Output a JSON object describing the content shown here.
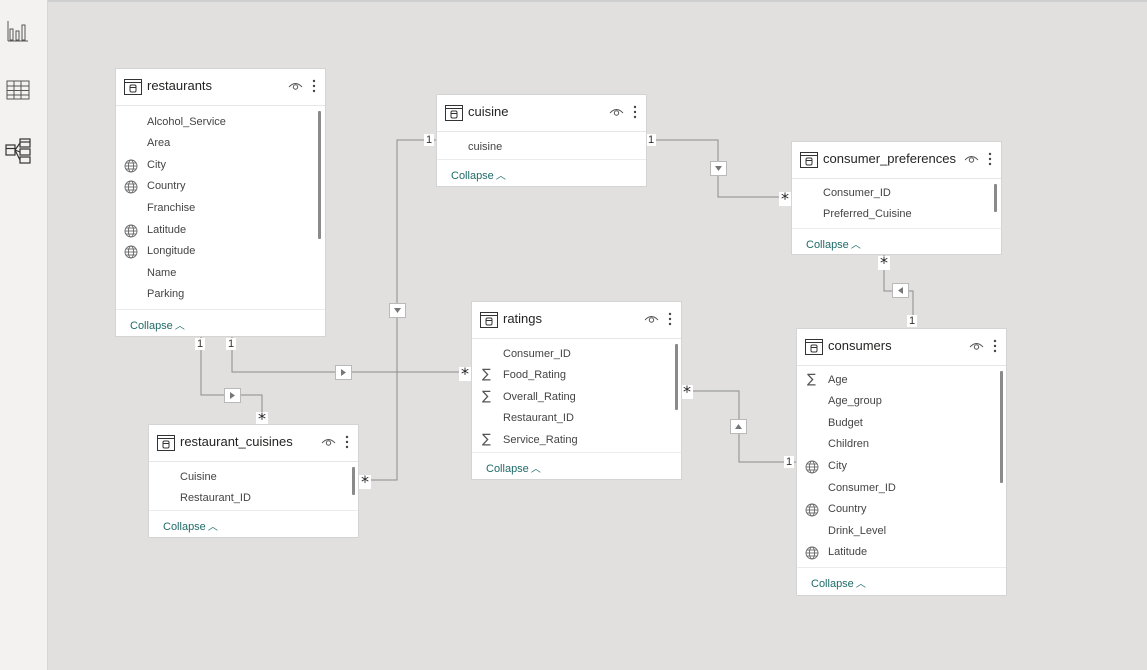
{
  "tables": {
    "restaurants": {
      "title": "restaurants",
      "fields": [
        {
          "name": "Alcohol_Service",
          "icon": "none"
        },
        {
          "name": "Area",
          "icon": "none"
        },
        {
          "name": "City",
          "icon": "globe-icon"
        },
        {
          "name": "Country",
          "icon": "globe-icon"
        },
        {
          "name": "Franchise",
          "icon": "none"
        },
        {
          "name": "Latitude",
          "icon": "globe-icon"
        },
        {
          "name": "Longitude",
          "icon": "globe-icon"
        },
        {
          "name": "Name",
          "icon": "none"
        },
        {
          "name": "Parking",
          "icon": "none"
        }
      ],
      "collapse": "Collapse"
    },
    "cuisine": {
      "title": "cuisine",
      "fields": [
        {
          "name": "cuisine",
          "icon": "none"
        }
      ],
      "collapse": "Collapse"
    },
    "consumer_preferences": {
      "title": "consumer_preferences",
      "fields": [
        {
          "name": "Consumer_ID",
          "icon": "none"
        },
        {
          "name": "Preferred_Cuisine",
          "icon": "none"
        }
      ],
      "collapse": "Collapse"
    },
    "ratings": {
      "title": "ratings",
      "fields": [
        {
          "name": "Consumer_ID",
          "icon": "none"
        },
        {
          "name": "Food_Rating",
          "icon": "sigma-icon"
        },
        {
          "name": "Overall_Rating",
          "icon": "sigma-icon"
        },
        {
          "name": "Restaurant_ID",
          "icon": "none"
        },
        {
          "name": "Service_Rating",
          "icon": "sigma-icon"
        }
      ],
      "collapse": "Collapse"
    },
    "consumers": {
      "title": "consumers",
      "fields": [
        {
          "name": "Age",
          "icon": "sigma-icon"
        },
        {
          "name": "Age_group",
          "icon": "none"
        },
        {
          "name": "Budget",
          "icon": "none"
        },
        {
          "name": "Children",
          "icon": "none"
        },
        {
          "name": "City",
          "icon": "globe-icon"
        },
        {
          "name": "Consumer_ID",
          "icon": "none"
        },
        {
          "name": "Country",
          "icon": "globe-icon"
        },
        {
          "name": "Drink_Level",
          "icon": "none"
        },
        {
          "name": "Latitude",
          "icon": "globe-icon"
        }
      ],
      "collapse": "Collapse"
    },
    "restaurant_cuisines": {
      "title": "restaurant_cuisines",
      "fields": [
        {
          "name": "Cuisine",
          "icon": "none"
        },
        {
          "name": "Restaurant_ID",
          "icon": "none"
        }
      ],
      "collapse": "Collapse"
    }
  },
  "cardinality": {
    "one": "1",
    "many": "*"
  },
  "colors": {
    "link_text": "#1f6b68",
    "line": "#8c8c8c",
    "canvas": "#e1e0de"
  },
  "nav": [
    "report-view-icon",
    "data-view-icon",
    "model-view-icon"
  ]
}
